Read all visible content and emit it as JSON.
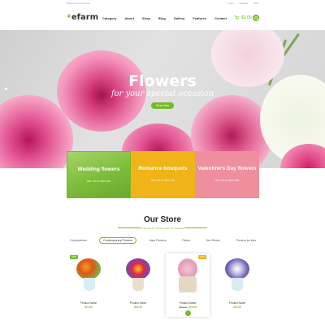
{
  "topbar": {
    "welcome": "Welcome to our store",
    "links": [
      "Log in",
      "Register",
      "USD"
    ]
  },
  "header": {
    "logo": "efarm",
    "nav": [
      "Category",
      "About",
      "Shop",
      "Blog",
      "Gallery",
      "Features",
      "Contact"
    ],
    "cart_total": "$0.00"
  },
  "hero": {
    "title": "Flowers",
    "subtitle": "for your special occasion",
    "button": "Shop Now"
  },
  "promos": [
    {
      "title": "Wedding flowers",
      "offer": "GET UP TO 40% OFF"
    },
    {
      "title": "Romance bouquets",
      "offer": "GET UP TO 30% OFF"
    },
    {
      "title": "Valentine's Day flowers",
      "offer": "GET UP TO 25% OFF"
    }
  ],
  "store": {
    "title": "Our Store",
    "subtitle": "THE MOST POPULAR FLOWERS",
    "tabs": [
      "Centerpieces",
      "Contemporary Flowers",
      "Vase Flowers",
      "Plants",
      "Sec Roses",
      "Flowers for kids"
    ],
    "active_tab": 1
  },
  "products": [
    {
      "name": "Product Name",
      "price": "$11.00",
      "old_price": "",
      "badge": "NEW"
    },
    {
      "name": "Product Name",
      "price": "$10.00",
      "old_price": "",
      "badge": ""
    },
    {
      "name": "Product Name",
      "price": "$75.00",
      "old_price": "$90.00",
      "badge": "SALE"
    },
    {
      "name": "Product Name",
      "price": "$11.00",
      "old_price": "",
      "badge": ""
    }
  ],
  "colors": {
    "accent": "#76b82a",
    "promo_yellow": "#f0b318",
    "promo_pink": "#ef8e9d"
  }
}
